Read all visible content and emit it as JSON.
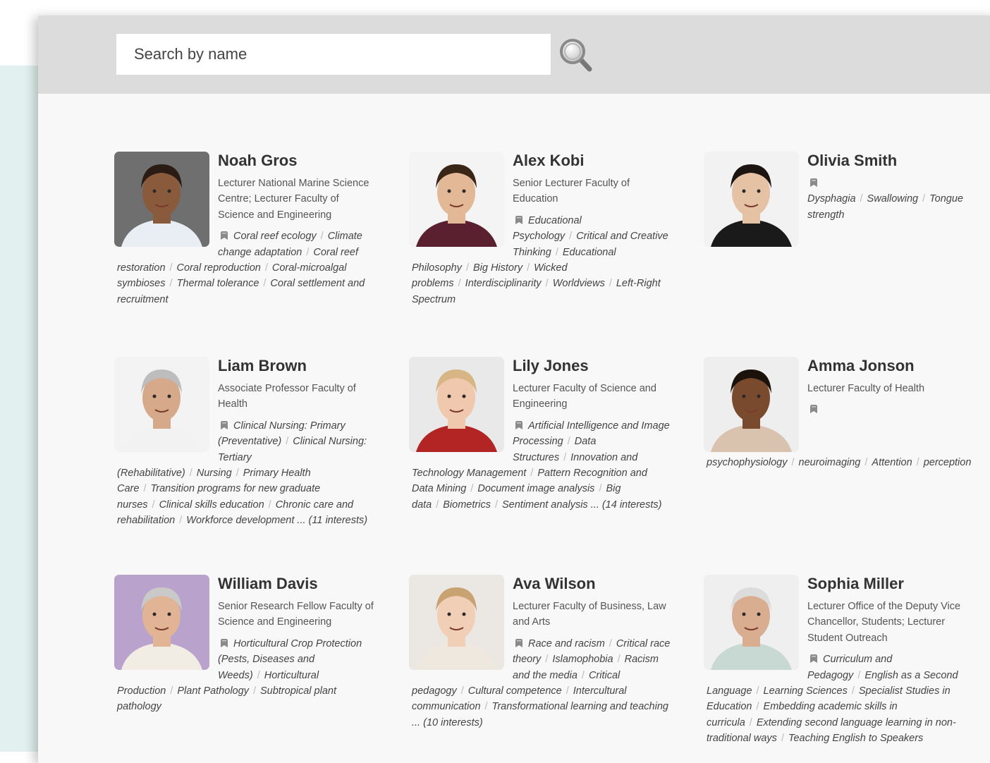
{
  "search": {
    "placeholder": "Search by name"
  },
  "colors": {
    "panel_bg": "#f8f8f8",
    "search_bar_bg": "#dcdcdc",
    "side_bg": "#e2f1ef",
    "name_text": "#333333"
  },
  "people": [
    {
      "name": "Noah Gros",
      "role": "Lecturer National Marine Science Centre; Lecturer Faculty of Science and Engineering",
      "interests": [
        "Coral reef ecology",
        "Climate change adaptation",
        "Coral reef restoration",
        "Coral reproduction",
        "Coral-microalgal symbioses",
        "Thermal tolerance",
        "Coral settlement and recruitment"
      ],
      "more": ""
    },
    {
      "name": "Alex Kobi",
      "role": "Senior Lecturer Faculty of Education",
      "interests": [
        "Educational Psychology",
        "Critical and Creative Thinking",
        "Educational Philosophy",
        "Big History",
        "Wicked problems",
        "Interdisciplinarity",
        "Worldviews",
        "Left-Right Spectrum"
      ],
      "more": ""
    },
    {
      "name": "Olivia Smith",
      "role": "",
      "interests": [
        "Dysphagia",
        "Swallowing",
        "Tongue strength"
      ],
      "more": ""
    },
    {
      "name": "Liam Brown",
      "role": "Associate Professor Faculty of Health",
      "interests": [
        "Clinical Nursing: Primary (Preventative)",
        "Clinical Nursing: Tertiary (Rehabilitative)",
        "Nursing",
        "Primary Health Care",
        "Transition programs for new graduate nurses",
        "Clinical skills education",
        "Chronic care and rehabilitation",
        "Workforce development"
      ],
      "more": "... (11 interests)"
    },
    {
      "name": "Lily Jones",
      "role": "Lecturer Faculty of Science and Engineering",
      "interests": [
        "Artificial Intelligence and Image Processing",
        "Data Structures",
        "Innovation and Technology Management",
        "Pattern Recognition and Data Mining",
        "Document image analysis",
        "Big data",
        "Biometrics",
        "Sentiment analysis"
      ],
      "more": "... (14 interests)"
    },
    {
      "name": "Amma Jonson",
      "role": "Lecturer Faculty of Health",
      "interests": [
        "psychophysiology",
        "neuroimaging",
        "Attention",
        "perception"
      ],
      "more": ""
    },
    {
      "name": "William Davis",
      "role": "Senior Research Fellow Faculty of Science and Engineering",
      "interests": [
        "Horticultural Crop Protection (Pests, Diseases and Weeds)",
        "Horticultural Production",
        "Plant Pathology",
        "Subtropical plant pathology"
      ],
      "more": ""
    },
    {
      "name": "Ava Wilson",
      "role": "Lecturer Faculty of Business, Law and Arts",
      "interests": [
        "Race and racism",
        "Critical race theory",
        "Islamophobia",
        "Racism and the media",
        "Critical pedagogy",
        "Cultural competence",
        "Intercultural communication",
        "Transformational learning and teaching"
      ],
      "more": "... (10 interests)"
    },
    {
      "name": "Sophia Miller",
      "role": "Lecturer Office of the Deputy Vice Chancellor, Students; Lecturer Student Outreach",
      "interests": [
        "Curriculum and Pedagogy",
        "English as a Second Language",
        "Learning Sciences",
        "Specialist Studies in Education",
        "Embedding academic skills in curricula",
        "Extending second language learning in non-traditional ways",
        "Teaching English to Speakers"
      ],
      "more": ""
    }
  ]
}
